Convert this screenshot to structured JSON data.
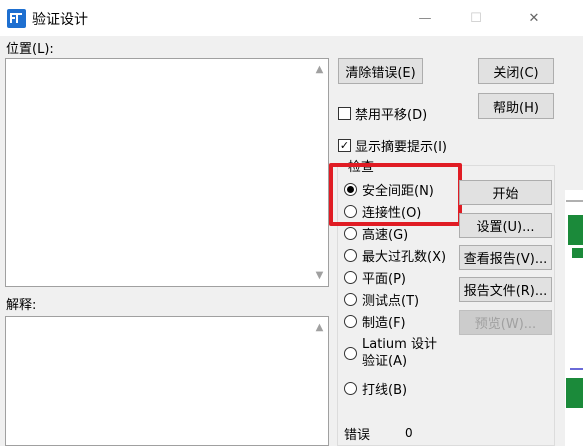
{
  "window": {
    "title": "验证设计",
    "minimize": "—",
    "maximize": "☐",
    "close": "✕"
  },
  "location": {
    "label": "位置(L):"
  },
  "explanation": {
    "label": "解释:"
  },
  "buttons": {
    "clear_errors": "清除错误(E)",
    "close": "关闭(C)",
    "help": "帮助(H)",
    "start": "开始",
    "settings": "设置(U)...",
    "view_report": "查看报告(V)...",
    "report_file": "报告文件(R)...",
    "preview": "预览(W)..."
  },
  "checkboxes": {
    "disable_pan": {
      "label": "禁用平移(D)",
      "checked": false,
      "mark": ""
    },
    "show_summary": {
      "label": "显示摘要提示(I)",
      "checked": true,
      "mark": "✓"
    }
  },
  "check_group": {
    "title": "检查",
    "options": [
      {
        "label": "安全间距(N)",
        "selected": true
      },
      {
        "label": "连接性(O)",
        "selected": false
      },
      {
        "label": "高速(G)",
        "selected": false
      },
      {
        "label": "最大过孔数(X)",
        "selected": false
      },
      {
        "label": "平面(P)",
        "selected": false
      },
      {
        "label": "测试点(T)",
        "selected": false
      },
      {
        "label": "制造(F)",
        "selected": false
      },
      {
        "label_line1": "Latium 设计",
        "label_line2": "验证(A)",
        "selected": false
      },
      {
        "label": "打线(B)",
        "selected": false
      }
    ]
  },
  "errors": {
    "label": "错误",
    "count": "0"
  },
  "colors": {
    "highlight": "#e01c24"
  }
}
